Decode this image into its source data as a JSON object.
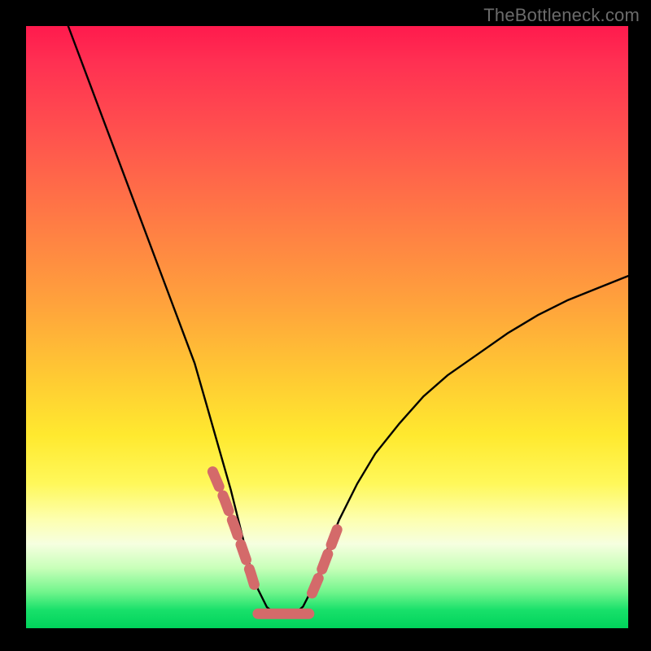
{
  "watermark": "TheBottleneck.com",
  "chart_data": {
    "type": "line",
    "title": "",
    "xlabel": "",
    "ylabel": "",
    "xlim": [
      0,
      100
    ],
    "ylim": [
      0,
      100
    ],
    "background_gradient_stops": [
      {
        "pct": 0,
        "color": "#ff1a4d"
      },
      {
        "pct": 6,
        "color": "#ff3052"
      },
      {
        "pct": 18,
        "color": "#ff524e"
      },
      {
        "pct": 32,
        "color": "#ff7a45"
      },
      {
        "pct": 46,
        "color": "#ffa23c"
      },
      {
        "pct": 58,
        "color": "#ffc933"
      },
      {
        "pct": 68,
        "color": "#ffe92f"
      },
      {
        "pct": 76,
        "color": "#fff85a"
      },
      {
        "pct": 82,
        "color": "#fdffb0"
      },
      {
        "pct": 86,
        "color": "#f6ffe0"
      },
      {
        "pct": 90,
        "color": "#c8ffb9"
      },
      {
        "pct": 94,
        "color": "#71f58c"
      },
      {
        "pct": 97,
        "color": "#18e06a"
      },
      {
        "pct": 100,
        "color": "#00d35b"
      }
    ],
    "series": [
      {
        "name": "bottleneck-curve",
        "color": "#000000",
        "x": [
          7,
          10,
          13,
          16,
          19,
          22,
          25,
          28,
          30,
          32,
          34,
          35.5,
          37,
          38.5,
          40,
          41.5,
          43,
          44.5,
          46,
          48,
          50,
          52,
          55,
          58,
          62,
          66,
          70,
          75,
          80,
          85,
          90,
          95,
          100
        ],
        "values": [
          100,
          92,
          84,
          76,
          68,
          60,
          52,
          44,
          37,
          30,
          23,
          17,
          11,
          6.5,
          3.5,
          2.3,
          2.0,
          2.3,
          3.6,
          7.5,
          13,
          18,
          24,
          29,
          34,
          38.5,
          42,
          45.5,
          49,
          52,
          54.5,
          56.5,
          58.5
        ]
      }
    ],
    "highlight_segments": {
      "name": "bottom-markers",
      "color": "#d46a6a",
      "left": {
        "x_start": 31,
        "x_end": 38,
        "y_start": 26,
        "y_end": 5
      },
      "floor": {
        "x_start": 38.5,
        "x_end": 47,
        "y": 2.4
      },
      "right": {
        "x_start": 47.5,
        "x_end": 52.5,
        "y_start": 5,
        "y_end": 18
      }
    }
  }
}
